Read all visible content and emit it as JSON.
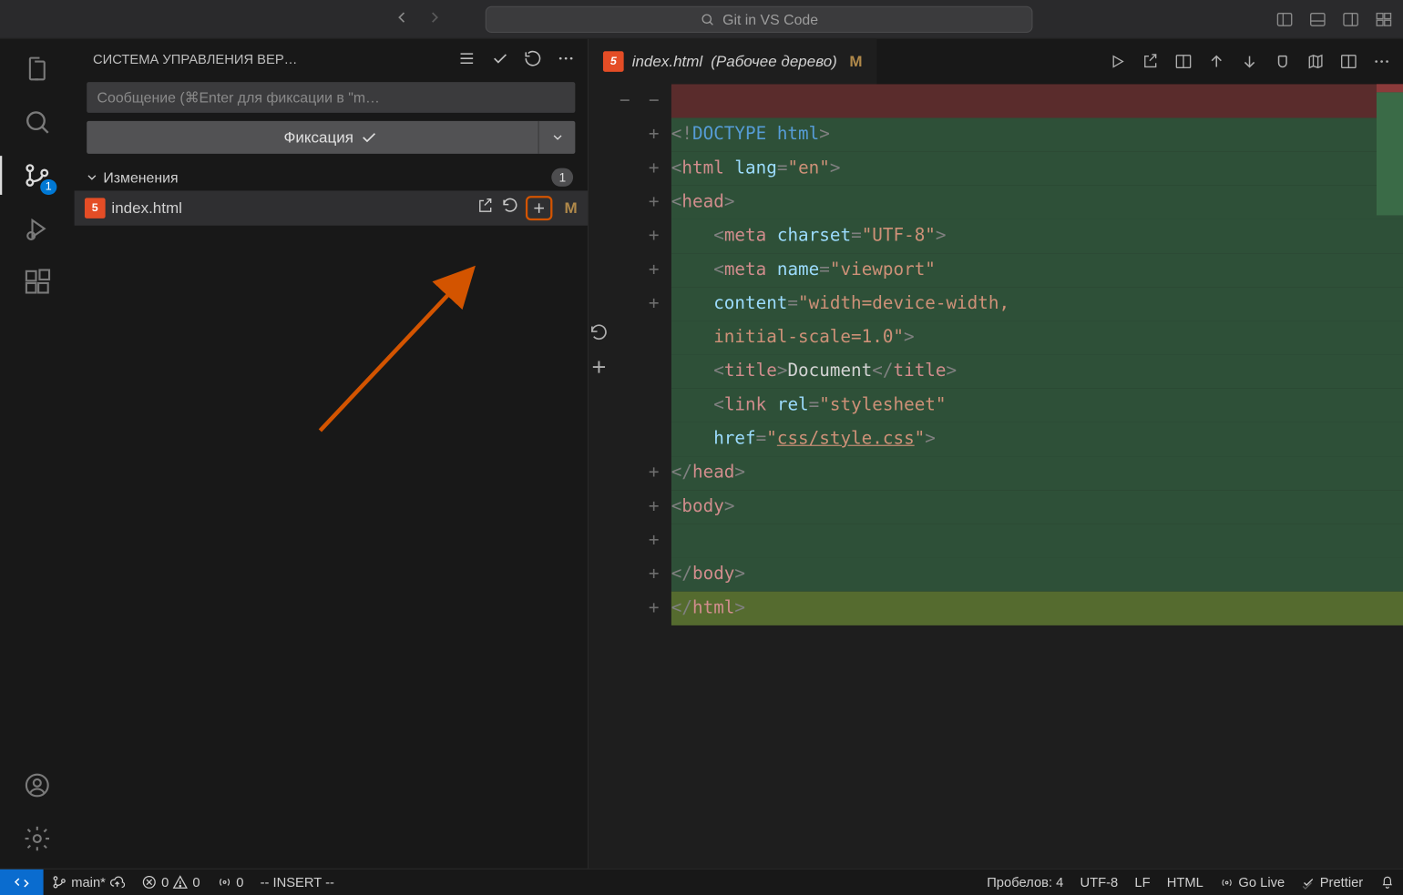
{
  "title_search": "Git in VS Code",
  "scm": {
    "panel_title": "СИСТЕМА УПРАВЛЕНИЯ ВЕР…",
    "commit_placeholder": "Сообщение (⌘Enter для фиксации в \"m…",
    "commit_button": "Фиксация",
    "section_label": "Изменения",
    "section_count": "1",
    "file_name": "index.html",
    "file_status": "M",
    "badge": "1"
  },
  "tab": {
    "file": "index.html",
    "suffix": "(Рабочее дерево)",
    "status": "M"
  },
  "code": {
    "lines": [
      {
        "g1": "−",
        "g2": "−",
        "cls": "row-red",
        "html": ""
      },
      {
        "g1": "",
        "g2": "+",
        "cls": "row-green",
        "html": "<span class='tk-punc'>&lt;!</span><span class='tk-doctype'>DOCTYPE</span> <span class='tk-doctype'>html</span><span class='tk-punc'>&gt;</span>"
      },
      {
        "g1": "",
        "g2": "+",
        "cls": "row-green",
        "html": "<span class='tk-punc'>&lt;</span><span class='tk-tagr'>html</span> <span class='tk-attr'>lang</span><span class='tk-punc'>=</span><span class='tk-str'>\"en\"</span><span class='tk-punc'>&gt;</span>"
      },
      {
        "g1": "",
        "g2": "+",
        "cls": "row-green",
        "html": "<span class='tk-punc'>&lt;</span><span class='tk-tagr'>head</span><span class='tk-punc'>&gt;</span>"
      },
      {
        "g1": "",
        "g2": "+",
        "cls": "row-green",
        "html": "    <span class='tk-punc'>&lt;</span><span class='tk-tagr'>meta</span> <span class='tk-attr'>charset</span><span class='tk-punc'>=</span><span class='tk-str'>\"UTF-8\"</span><span class='tk-punc'>&gt;</span>"
      },
      {
        "g1": "",
        "g2": "+",
        "cls": "row-green",
        "html": "    <span class='tk-punc'>&lt;</span><span class='tk-tagr'>meta</span> <span class='tk-attr'>name</span><span class='tk-punc'>=</span><span class='tk-str'>\"viewport\"</span>"
      },
      {
        "g1": "",
        "g2": "+",
        "cls": "row-green",
        "html": "    <span class='tk-attr'>content</span><span class='tk-punc'>=</span><span class='tk-str'>\"width=device-width,</span>"
      },
      {
        "g1": "",
        "g2": "",
        "cls": "row-green",
        "html": "    <span class='tk-str'>initial-scale=1.0\"</span><span class='tk-punc'>&gt;</span>",
        "left_icon": "revert"
      },
      {
        "g1": "",
        "g2": "",
        "cls": "row-green",
        "html": "    <span class='tk-punc'>&lt;</span><span class='tk-tagr'>title</span><span class='tk-punc'>&gt;</span><span class='tk-text'>Document</span><span class='tk-punc'>&lt;/</span><span class='tk-tagr'>title</span><span class='tk-punc'>&gt;</span>",
        "left_icon": "plus"
      },
      {
        "g1": "",
        "g2": "",
        "cls": "row-green",
        "html": "    <span class='tk-punc'>&lt;</span><span class='tk-tagr'>link</span> <span class='tk-attr'>rel</span><span class='tk-punc'>=</span><span class='tk-str'>\"stylesheet\"</span>"
      },
      {
        "g1": "",
        "g2": "",
        "cls": "row-green",
        "html": "    <span class='tk-attr'>href</span><span class='tk-punc'>=</span><span class='tk-str'>\"</span><span class='tk-link'>css/style.css</span><span class='tk-str'>\"</span><span class='tk-punc'>&gt;</span>"
      },
      {
        "g1": "",
        "g2": "+",
        "cls": "row-green",
        "html": "<span class='tk-punc'>&lt;/</span><span class='tk-tagr'>head</span><span class='tk-punc'>&gt;</span>"
      },
      {
        "g1": "",
        "g2": "+",
        "cls": "row-green",
        "html": "<span class='tk-punc'>&lt;</span><span class='tk-tagr'>body</span><span class='tk-punc'>&gt;</span>"
      },
      {
        "g1": "",
        "g2": "+",
        "cls": "row-green",
        "html": ""
      },
      {
        "g1": "",
        "g2": "+",
        "cls": "row-green",
        "html": "<span class='tk-punc'>&lt;/</span><span class='tk-tagr'>body</span><span class='tk-punc'>&gt;</span>"
      },
      {
        "g1": "",
        "g2": "+",
        "cls": "sel-green",
        "html": "<span class='tk-punc'>&lt;/</span><span class='tk-tagr'>html</span><span class='tk-punc'>&gt;</span>"
      }
    ]
  },
  "status": {
    "branch": "main*",
    "errors": "0",
    "warnings": "0",
    "ports": "0",
    "mode": "-- INSERT --",
    "spaces": "Пробелов: 4",
    "encoding": "UTF-8",
    "eol": "LF",
    "lang": "HTML",
    "golive": "Go Live",
    "prettier": "Prettier"
  }
}
